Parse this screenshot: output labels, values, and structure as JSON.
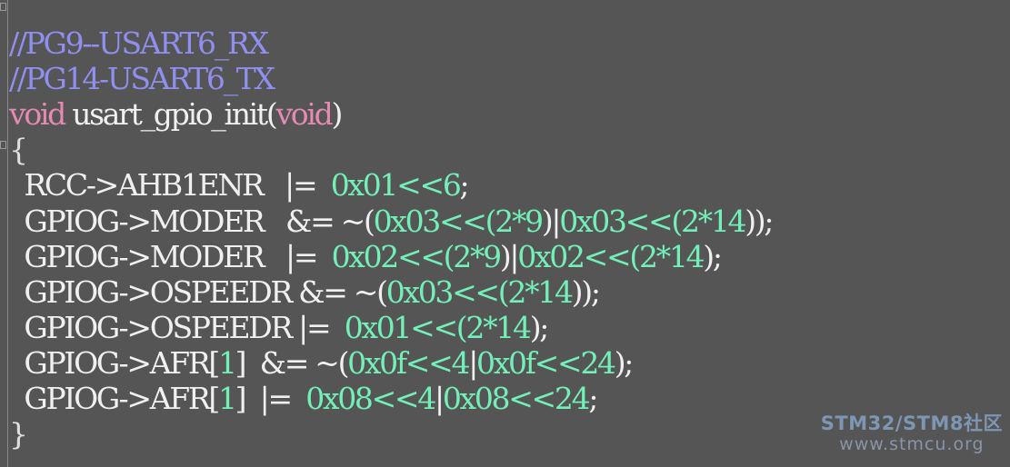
{
  "editor": {
    "lines": [
      {
        "tokens": [
          {
            "type": "comment",
            "text": "//PG9--USART6_RX"
          }
        ]
      },
      {
        "tokens": [
          {
            "type": "comment",
            "text": "//PG14-USART6_TX"
          }
        ]
      },
      {
        "tokens": [
          {
            "type": "keyword",
            "text": "void"
          },
          {
            "type": "default",
            "text": " usart_gpio_init("
          },
          {
            "type": "keyword",
            "text": "void"
          },
          {
            "type": "default",
            "text": ")"
          }
        ]
      },
      {
        "tokens": [
          {
            "type": "brace",
            "text": "{"
          }
        ]
      },
      {
        "tokens": [
          {
            "type": "default",
            "text": "  RCC->AHB1ENR   |=  "
          },
          {
            "type": "number",
            "text": "0x01<<6"
          },
          {
            "type": "default",
            "text": ";"
          }
        ]
      },
      {
        "tokens": [
          {
            "type": "default",
            "text": "  GPIOG->MODER   &= ~("
          },
          {
            "type": "number",
            "text": "0x03<<("
          },
          {
            "type": "number",
            "text": "2*9"
          },
          {
            "type": "default",
            "text": ")|"
          },
          {
            "type": "number",
            "text": "0x03<<("
          },
          {
            "type": "number",
            "text": "2*14"
          },
          {
            "type": "default",
            "text": "));"
          }
        ]
      },
      {
        "tokens": [
          {
            "type": "default",
            "text": "  GPIOG->MODER   |=  "
          },
          {
            "type": "number",
            "text": "0x02<<("
          },
          {
            "type": "number",
            "text": "2*9"
          },
          {
            "type": "default",
            "text": ")|"
          },
          {
            "type": "number",
            "text": "0x02<<("
          },
          {
            "type": "number",
            "text": "2*14"
          },
          {
            "type": "default",
            "text": ");"
          }
        ]
      },
      {
        "tokens": [
          {
            "type": "default",
            "text": "  GPIOG->OSPEEDR &= ~("
          },
          {
            "type": "number",
            "text": "0x03<<("
          },
          {
            "type": "number",
            "text": "2*14"
          },
          {
            "type": "default",
            "text": "));"
          }
        ]
      },
      {
        "tokens": [
          {
            "type": "default",
            "text": "  GPIOG->OSPEEDR |=  "
          },
          {
            "type": "number",
            "text": "0x01<<("
          },
          {
            "type": "number",
            "text": "2*14"
          },
          {
            "type": "default",
            "text": ");"
          }
        ]
      },
      {
        "tokens": [
          {
            "type": "default",
            "text": "  GPIOG->AFR["
          },
          {
            "type": "number",
            "text": "1"
          },
          {
            "type": "default",
            "text": "]  &= ~("
          },
          {
            "type": "number",
            "text": "0x0f<<4"
          },
          {
            "type": "default",
            "text": "|"
          },
          {
            "type": "number",
            "text": "0x0f<<24"
          },
          {
            "type": "default",
            "text": ");"
          }
        ]
      },
      {
        "tokens": [
          {
            "type": "default",
            "text": "  GPIOG->AFR["
          },
          {
            "type": "number",
            "text": "1"
          },
          {
            "type": "default",
            "text": "]  |=  "
          },
          {
            "type": "number",
            "text": "0x08<<4"
          },
          {
            "type": "default",
            "text": "|"
          },
          {
            "type": "number",
            "text": "0x08<<24"
          },
          {
            "type": "default",
            "text": ";"
          }
        ]
      },
      {
        "tokens": [
          {
            "type": "brace",
            "text": "}"
          }
        ]
      }
    ]
  },
  "watermark": {
    "title": "STM32/STM8社区",
    "url": "www.stmcu.org"
  },
  "colors": {
    "background": "#555555",
    "comment": "#8f8ff0",
    "keyword": "#e58ab2",
    "number": "#73f0b8",
    "default": "#f0f0f0"
  }
}
